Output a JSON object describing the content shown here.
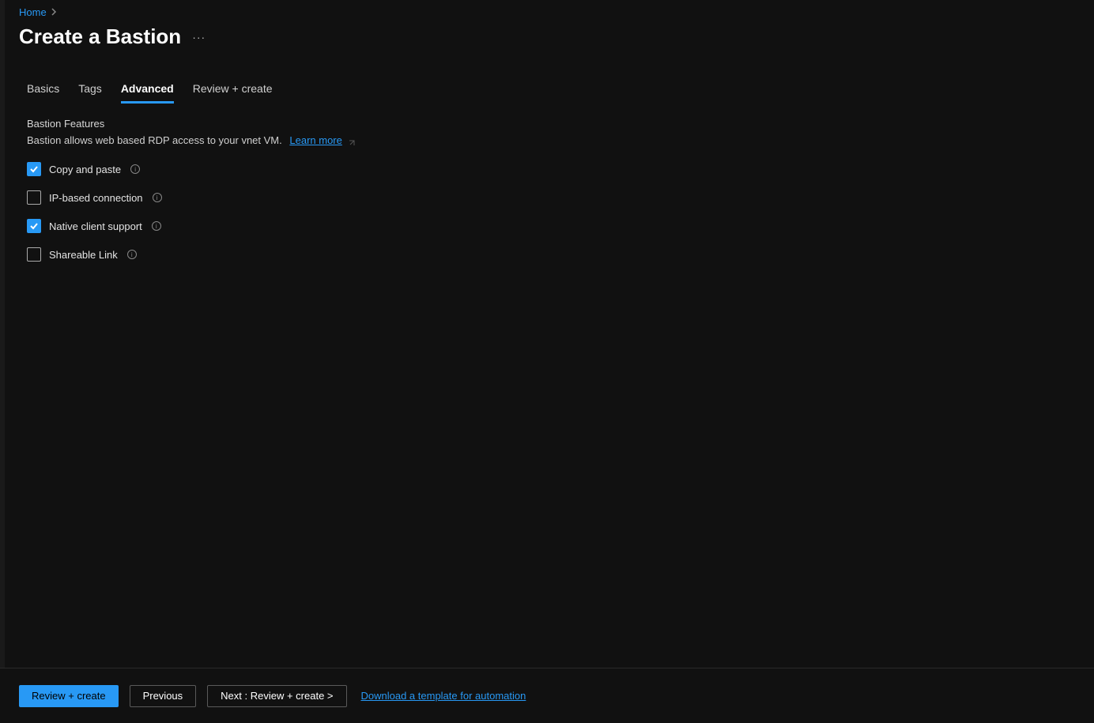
{
  "breadcrumb": {
    "home": "Home"
  },
  "title": "Create a Bastion",
  "tabs": {
    "basics": "Basics",
    "tags": "Tags",
    "advanced": "Advanced",
    "review": "Review + create"
  },
  "section": {
    "heading": "Bastion Features",
    "desc": "Bastion allows web based RDP access to your vnet VM.",
    "learn_more": "Learn more"
  },
  "features": {
    "copy_paste": {
      "label": "Copy and paste",
      "checked": true
    },
    "ip_based": {
      "label": "IP-based connection",
      "checked": false
    },
    "native_client": {
      "label": "Native client support",
      "checked": true
    },
    "shareable_link": {
      "label": "Shareable Link",
      "checked": false
    }
  },
  "footer": {
    "review": "Review + create",
    "previous": "Previous",
    "next": "Next : Review + create >",
    "download": "Download a template for automation"
  }
}
